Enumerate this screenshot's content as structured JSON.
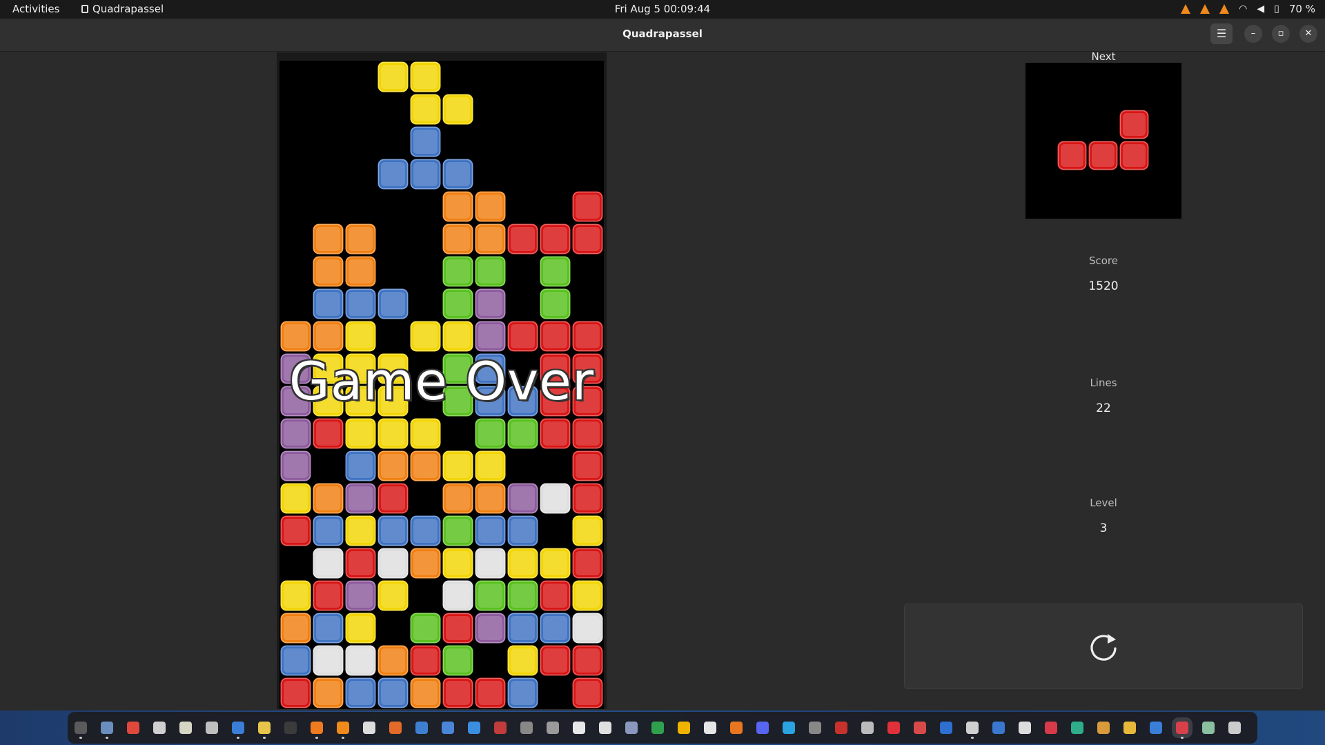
{
  "topbar": {
    "activities": "Activities",
    "app_name": "Quadrapassel",
    "clock": "Fri Aug 5  00:09:44",
    "battery": "70 %",
    "tray_icons": [
      "vlc-icon",
      "vlc-icon",
      "vlc-icon",
      "wifi-icon",
      "volume-icon",
      "battery-icon"
    ]
  },
  "window": {
    "title": "Quadrapassel",
    "menu_icon": "hamburger-menu-icon",
    "minimize_icon": "minimize-icon",
    "maximize_icon": "maximize-icon",
    "close_icon": "close-icon"
  },
  "game": {
    "overlay_text": "Game Over",
    "colors": {
      "Y": "#f2d500",
      "B": "#3e72c2",
      "O": "#f07f10",
      "R": "#d81414",
      "G": "#58c01c",
      "P": "#8c5a9c",
      "W": "#dedede"
    },
    "board": {
      "columns": 10,
      "rows": 20,
      "grid": [
        "...YY.....",
        "....YY....",
        "....B.....",
        "...BBB....",
        ".....OO..R",
        ".OO..OORRR",
        ".OO..GG.G.",
        ".BBB.GP.G.",
        "OOY.YYPRRR",
        "PYYY.GB.RR",
        "PYYY.GBBRR",
        "PRYYY.GGRR",
        "P.BOOYY..R",
        "YOPR.OOPWR",
        "RBYBBGBB.Y",
        ".WRWOYWYYR",
        "YRPY.WGGRY",
        "OBY.GRPBBW",
        "BWWORG.YRR",
        "ROBBORRB.R"
      ]
    },
    "next": {
      "label": "Next",
      "piece_name": "L",
      "color": "R",
      "cells": [
        [
          2,
          0
        ],
        [
          0,
          1
        ],
        [
          1,
          1
        ],
        [
          2,
          1
        ]
      ]
    },
    "score": {
      "label": "Score",
      "value": "1520"
    },
    "lines": {
      "label": "Lines",
      "value": "22"
    },
    "level": {
      "label": "Level",
      "value": "3"
    },
    "new_game_icon": "restart-icon"
  },
  "dock": {
    "apps": [
      {
        "icon": "system-monitor-icon",
        "color": "#5a5a5a",
        "running": true
      },
      {
        "icon": "files-icon",
        "color": "#6a8fbf",
        "running": true
      },
      {
        "icon": "chrome-icon",
        "color": "#e0483e",
        "running": false
      },
      {
        "icon": "text-editor-icon",
        "color": "#cfcfcf",
        "running": false
      },
      {
        "icon": "notes-icon",
        "color": "#d6d6c4",
        "running": false
      },
      {
        "icon": "document-viewer-icon",
        "color": "#bfbfbf",
        "running": false
      },
      {
        "icon": "writer-icon",
        "color": "#3a7ed8",
        "running": true
      },
      {
        "icon": "calc-icon",
        "color": "#e8c54a",
        "running": true
      },
      {
        "icon": "terminal-icon",
        "color": "#3b3b3b",
        "running": false
      },
      {
        "icon": "firefox-icon",
        "color": "#f07a1e",
        "running": true
      },
      {
        "icon": "vlc-icon",
        "color": "#f08a1c",
        "running": true
      },
      {
        "icon": "obs-icon",
        "color": "#dddddd",
        "running": false
      },
      {
        "icon": "software-icon",
        "color": "#e46a2a",
        "running": false
      },
      {
        "icon": "draw-icon",
        "color": "#3f7fd0",
        "running": false
      },
      {
        "icon": "calendar-icon",
        "color": "#4a86d8",
        "running": false
      },
      {
        "icon": "help-icon",
        "color": "#3b8ee0",
        "running": false
      },
      {
        "icon": "usage-icon",
        "color": "#c23c3c",
        "running": false
      },
      {
        "icon": "camera-icon",
        "color": "#888888",
        "running": false
      },
      {
        "icon": "ship-icon",
        "color": "#9a9a9a",
        "running": false
      },
      {
        "icon": "inkscape-icon",
        "color": "#e8e8e8",
        "running": false
      },
      {
        "icon": "box-icon",
        "color": "#e0e0e0",
        "running": false
      },
      {
        "icon": "screenshot-icon",
        "color": "#8a98c0",
        "running": false
      },
      {
        "icon": "sheets-icon",
        "color": "#2ea04e",
        "running": false
      },
      {
        "icon": "slides-icon",
        "color": "#f0b400",
        "running": false
      },
      {
        "icon": "document-icon",
        "color": "#e6e6e6",
        "running": false
      },
      {
        "icon": "impress-icon",
        "color": "#e87620",
        "running": false
      },
      {
        "icon": "discord-icon",
        "color": "#5865f2",
        "running": false
      },
      {
        "icon": "telegram-icon",
        "color": "#2aa3e0",
        "running": false
      },
      {
        "icon": "gnome-icon",
        "color": "#888888",
        "running": false
      },
      {
        "icon": "pdf-icon",
        "color": "#c8322c",
        "running": false
      },
      {
        "icon": "percent-icon",
        "color": "#bbbbbb",
        "running": false
      },
      {
        "icon": "screen-recorder-icon",
        "color": "#e0303a",
        "running": false
      },
      {
        "icon": "gallery-icon",
        "color": "#d84a4a",
        "running": false
      },
      {
        "icon": "word-icon",
        "color": "#2e6fd0",
        "running": false
      },
      {
        "icon": "settings-icon",
        "color": "#d0d0d0",
        "running": true
      },
      {
        "icon": "chart-icon",
        "color": "#3a78d0",
        "running": false
      },
      {
        "icon": "clock-icon",
        "color": "#dddddd",
        "running": false
      },
      {
        "icon": "heart-icon",
        "color": "#d83a4a",
        "running": false
      },
      {
        "icon": "graph-icon",
        "color": "#2fae8a",
        "running": false
      },
      {
        "icon": "character-icon",
        "color": "#d89a3a",
        "running": false
      },
      {
        "icon": "chat-icon",
        "color": "#e8b83a",
        "running": false
      },
      {
        "icon": "remote-icon",
        "color": "#3a7ed8",
        "running": false
      },
      {
        "icon": "quadrapassel-icon",
        "color": "#d8404a",
        "running": true,
        "current": true
      },
      {
        "icon": "trash-icon",
        "color": "#8ac0a0",
        "running": false
      },
      {
        "icon": "show-apps-icon",
        "color": "#cccccc",
        "running": false
      }
    ]
  }
}
